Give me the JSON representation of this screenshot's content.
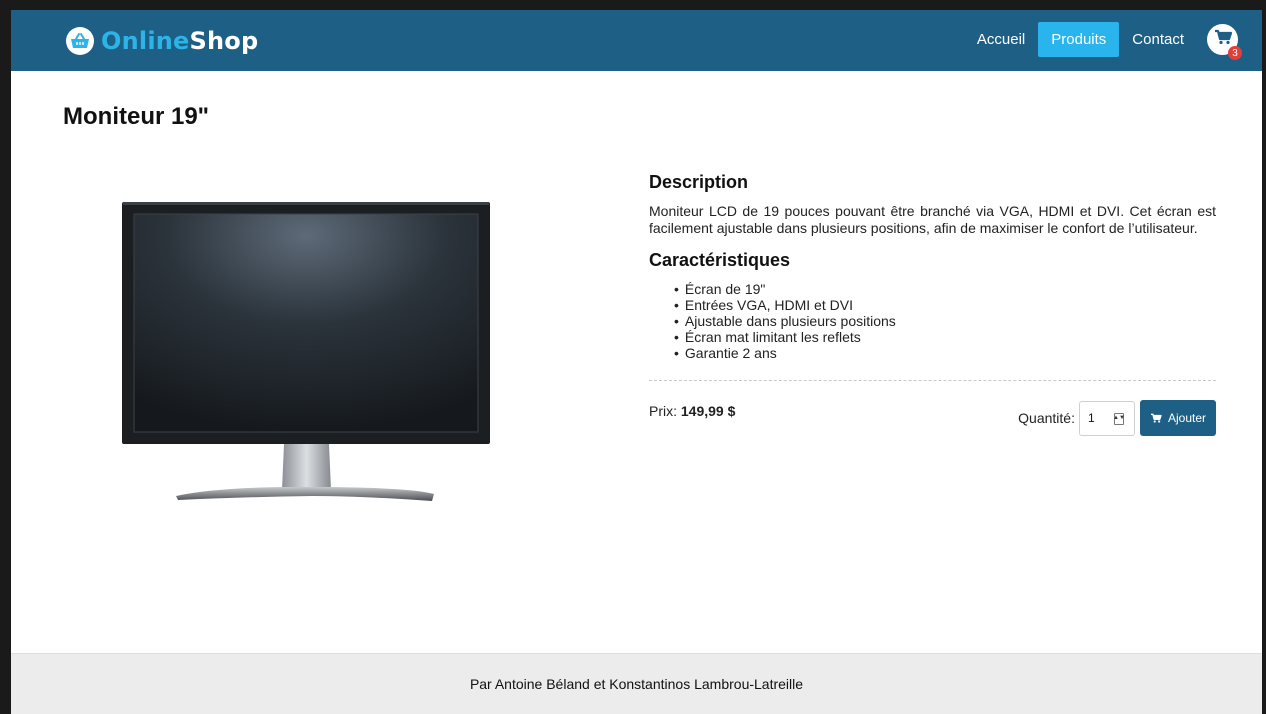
{
  "header": {
    "brand_part1": "Online",
    "brand_part2": "Shop",
    "brand_icon": "shopping-basket-icon",
    "nav": [
      {
        "label": "Accueil",
        "active": false
      },
      {
        "label": "Produits",
        "active": true
      },
      {
        "label": "Contact",
        "active": false
      }
    ],
    "cart_icon": "shopping-cart-icon",
    "cart_count": "3"
  },
  "product": {
    "title": "Moniteur 19\"",
    "image_alt": "monitor-image",
    "description_heading": "Description",
    "description": "Moniteur LCD de 19 pouces pouvant être branché via VGA, HDMI et DVI. Cet écran est facilement ajustable dans plusieurs positions, afin de maximiser le confort de l’utilisateur.",
    "features_heading": "Caractéristiques",
    "features": [
      "Écran de 19\"",
      "Entrées VGA, HDMI et DVI",
      "Ajustable dans plusieurs positions",
      "Écran mat limitant les reflets",
      "Garantie 2 ans"
    ],
    "price_label": "Prix:",
    "price": "149,99 $",
    "quantity_label": "Quantité:",
    "quantity": "1",
    "add_button": "Ajouter"
  },
  "footer": {
    "text": "Par Antoine Béland et Konstantinos Lambrou-Latreille"
  },
  "colors": {
    "header_bg": "#1e5f86",
    "accent": "#29b4ee",
    "badge": "#e0403a",
    "footer_bg": "#ececec"
  }
}
